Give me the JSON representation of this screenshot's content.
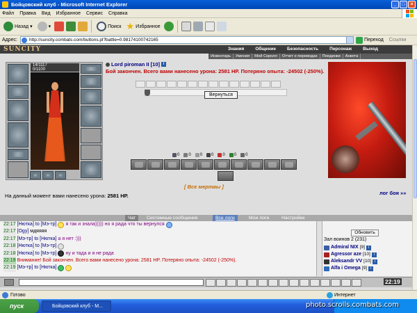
{
  "window": {
    "title": "Бойцовский клуб - Microsoft Internet Explorer"
  },
  "menu": [
    "Файл",
    "Правка",
    "Вид",
    "Избранное",
    "Сервис",
    "Справка"
  ],
  "toolbar": {
    "back": "Назад",
    "search": "Поиск",
    "favorites": "Избранное"
  },
  "address": {
    "label": "Адрес:",
    "url": "http://suncity.combats.com/buttons.pl?battle=0.98174100742165",
    "go": "Переход",
    "links": "Ссылки"
  },
  "game": {
    "logo": "SUNCITY",
    "nav": [
      "Знания",
      "Общение",
      "Безопасность",
      "Персонаж",
      "Выход"
    ],
    "subnav": [
      "Инвентарь",
      "Умения",
      "Мой Скролл",
      "Отчет о переводах",
      "Поединки",
      "Анкета"
    ]
  },
  "character": {
    "hp": "14/1117",
    "mana": "0/1100"
  },
  "battle": {
    "opponent": "Lord piroman II [10]",
    "result": "Бой закончен. Всего вами нанесено урона: 2581 HP. Потеряно опыта: -24502 (-250%).",
    "return_btn": "Вернуться",
    "counters": [
      "0",
      "0",
      "0",
      "0",
      "0",
      "0",
      "0"
    ],
    "all_dead": "[ Все мертвы ]",
    "log_link": "лог боя »»",
    "damage_label": "На данный момент вами нанесено урона:",
    "damage_value": "2581 HP."
  },
  "chat": {
    "tabs": [
      "Чат",
      "Системные сообщения",
      "Все логи",
      "Мои логи",
      "Настройки"
    ],
    "lines": [
      {
        "time": "22:17",
        "nick": "[Нютка]",
        "to": "to [Мэ-тр]",
        "text": "я так и знала))))) но я рада что ты вернулся"
      },
      {
        "time": "22:17",
        "nick": "[Ogy]",
        "to": "",
        "text": "мдяяяя"
      },
      {
        "time": "22:17",
        "nick": "[Мэ-тр]",
        "to": "to [Нютка]",
        "text": "а я нет :)))"
      },
      {
        "time": "22:18",
        "nick": "[Нютка]",
        "to": "to [Мэ-тр]",
        "text": ""
      },
      {
        "time": "22:18",
        "nick": "[Нютка]",
        "to": "to [Мэ-тр]",
        "text": "ну и тада и я не рада"
      },
      {
        "time": "22:19",
        "nick": "",
        "to": "",
        "text": "Внимание! Бой закончен. Всего вами нанесено урона: 2581 HP. Потеряно опыта: -24502 (-250%)."
      },
      {
        "time": "22:19",
        "nick": "[Мэ-тр]",
        "to": "to [Нютка]",
        "text": ""
      }
    ],
    "alert_label": "Внимание!"
  },
  "online": {
    "refresh": "Обновить",
    "location": "Зал воинов 2 (231)",
    "users": [
      {
        "name": "Admiral NIX",
        "level": "[9]"
      },
      {
        "name": "Agressor aze",
        "level": "[10]"
      },
      {
        "name": "Aleksandr VV",
        "level": "[10]"
      },
      {
        "name": "Alfa i Omega",
        "level": "[9]"
      }
    ]
  },
  "clock": "22:19",
  "status": {
    "left": "Готово",
    "zone": "Интернет"
  },
  "taskbar": {
    "start": "пуск",
    "task": "Бойцовский клуб - M..."
  },
  "watermark": "photo.scrolls.combats.com",
  "colors": {
    "ie_blue": "#0453c7",
    "result_red": "#c00000",
    "nick_blue": "#000080",
    "all_dead_orange": "#c56d00"
  }
}
